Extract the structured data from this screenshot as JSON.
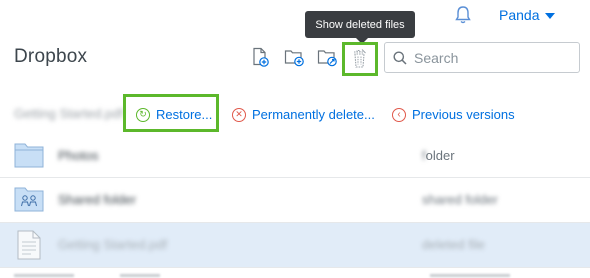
{
  "header": {
    "user_name": "Panda",
    "tooltip": "Show deleted files",
    "page_title": "Dropbox",
    "toolbar_icons": [
      "upload-file-icon",
      "new-folder-icon",
      "share-folder-icon",
      "show-deleted-icon"
    ],
    "search": {
      "placeholder": "Search",
      "value": ""
    }
  },
  "selection": {
    "name": "Getting Started.pdf",
    "actions": [
      {
        "label": "Restore...",
        "icon": "restore-icon"
      },
      {
        "label": "Permanently delete...",
        "icon": "delete-icon"
      },
      {
        "label": "Previous versions",
        "icon": "history-icon"
      }
    ]
  },
  "files": [
    {
      "name": "Photos",
      "modified": "folder",
      "modified_visible": "older",
      "icon": "folder-icon",
      "selected": false,
      "deleted": false
    },
    {
      "name": "Shared folder",
      "modified": "shared folder",
      "icon": "shared-folder-icon",
      "selected": false,
      "deleted": false
    },
    {
      "name": "Getting Started.pdf",
      "modified": "deleted file",
      "icon": "document-icon",
      "selected": true,
      "deleted": true
    }
  ],
  "colors": {
    "accent": "#0070e0",
    "highlight": "#5cb82b",
    "tooltip_bg": "#3a3d41",
    "selected_row": "#e1ecf8",
    "folder": "#c8dff6"
  }
}
